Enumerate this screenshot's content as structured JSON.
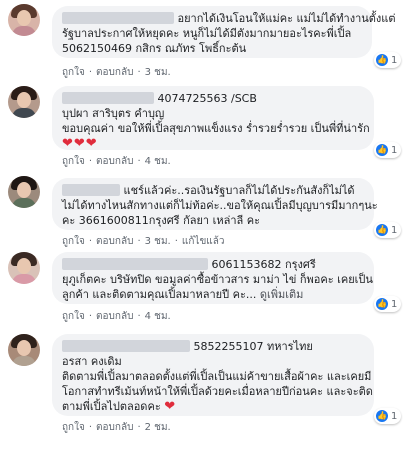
{
  "comments": [
    {
      "text_lines": [
        "อยากได้เงินโอนให้แม่คะ แม่ไม่ได้ทำงานตั้งแต่",
        "รัฐบาลประกาศให้หยุดคะ หนูก็ไม่ได้มีตังมากมายอะไรคะพี่เปิ้ล",
        "5062150469 กสิกร ณภัทร โพธิ์กะต้น"
      ],
      "like_count": "1",
      "actions": {
        "like": "ถูกใจ",
        "reply": "ตอบกลับ",
        "time": "3 ชม."
      }
    },
    {
      "name_suffix": "4074725563 /SCB",
      "text_lines": [
        "บุปผา สาริบุตร คำบุญ",
        "ขอบคุณค่า ขอให้พี่เปิ้ลสุขภาพแข็งแรง ร่ำรวยร่ำรวย เป็นพี่ที่น่ารัก"
      ],
      "hearts": "❤❤❤",
      "like_count": "1",
      "actions": {
        "like": "ถูกใจ",
        "reply": "ตอบกลับ",
        "time": "4 ชม."
      }
    },
    {
      "text_lines": [
        "แชร์แล้วค่ะ..รอเงินรัฐบาลก็ไม่ได้ประกันสังก็ไม่ได้",
        "ไม่ได้ทางไหนสักทางแต่ก็ไม่ท้อค่ะ..ขอให้คุณเปิ้ลมีบุญบารมีมากๆนะ",
        "คะ 3661600811กรุงศรี กัลยา เหล่าลี คะ"
      ],
      "like_count": "1",
      "actions": {
        "like": "ถูกใจ",
        "reply": "ตอบกลับ",
        "time": "3 ชม.",
        "edited": "แก้ไขแล้ว"
      }
    },
    {
      "name_suffix": "6061153682 กรุงศรี",
      "text_lines": [
        "ยุภูเก็ตคะ บริษัทปิด ขอมูลค่าซื้อข้าวสาร มาม่า ไข่ ก็พอคะ เคยเป็น",
        "ลูกค้า และติดตามคุณเปิ้ลมาหลายปี คะ..."
      ],
      "see_more": "ดูเพิ่มเติม",
      "like_count": "1",
      "actions": {
        "like": "ถูกใจ",
        "reply": "ตอบกลับ",
        "time": "4 ชม."
      }
    },
    {
      "name_suffix": "5852255107 ทหารไทย",
      "text_lines": [
        "อรสา คงเดิม",
        "ติดตามพี่เปิ้ลมาตลอดตั้งแต่พี่เปิ้ลเป็นแม่ค้าขายเสื้อผ้าคะ และเคยมี",
        "โอกาสทำทรีเม้นท์หน้าให้พี่เปิ้ลด้วยคะเมื่อหลายปีก่อนคะ และจะติด",
        "ตามพี่เปิ้ลไปตลอดคะ"
      ],
      "hearts": "❤",
      "like_count": "1",
      "actions": {
        "like": "ถูกใจ",
        "reply": "ตอบกลับ",
        "time": "2 ชม."
      }
    }
  ],
  "colors": {
    "bubble": "#f2f3f5",
    "heart": "#e02c3c",
    "like_blue": "#1877f2",
    "meta": "#606770"
  }
}
